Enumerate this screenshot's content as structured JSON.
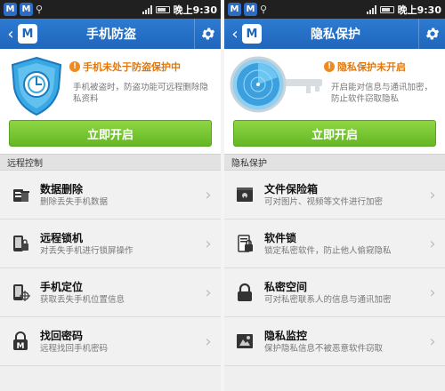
{
  "left": {
    "status_bar": {
      "time": "晚上9:30",
      "badge1": "M",
      "badge2": "M"
    },
    "nav": {
      "title": "手机防盗"
    },
    "hero": {
      "status": "手机未处于防盗保护中",
      "description": "手机被盗时，防盗功能可远程删除隐私资料",
      "button": "立即开启"
    },
    "section": "远程控制",
    "items": [
      {
        "title": "数据删除",
        "subtitle": "删除丢失手机数据"
      },
      {
        "title": "远程锁机",
        "subtitle": "对丢失手机进行锁屏操作"
      },
      {
        "title": "手机定位",
        "subtitle": "获取丢失手机位置信息"
      },
      {
        "title": "找回密码",
        "subtitle": "远程找回手机密码"
      }
    ]
  },
  "right": {
    "status_bar": {
      "time": "晚上9:30",
      "badge1": "M",
      "badge2": "M"
    },
    "nav": {
      "title": "隐私保护"
    },
    "hero": {
      "status": "隐私保护未开启",
      "description": "开启能对信息与通讯加密，防止软件窃取隐私",
      "button": "立即开启"
    },
    "section": "隐私保护",
    "items": [
      {
        "title": "文件保险箱",
        "subtitle": "可对图片、视频等文件进行加密"
      },
      {
        "title": "软件锁",
        "subtitle": "锁定私密软件，防止他人偷窥隐私"
      },
      {
        "title": "私密空间",
        "subtitle": "可对私密联系人的信息与通讯加密"
      },
      {
        "title": "隐私监控",
        "subtitle": "保护隐私信息不被恶意软件窃取"
      }
    ]
  },
  "colors": {
    "nav_blue": "#1f66bc",
    "button_green": "#64b723",
    "alert_orange": "#e0780e"
  }
}
